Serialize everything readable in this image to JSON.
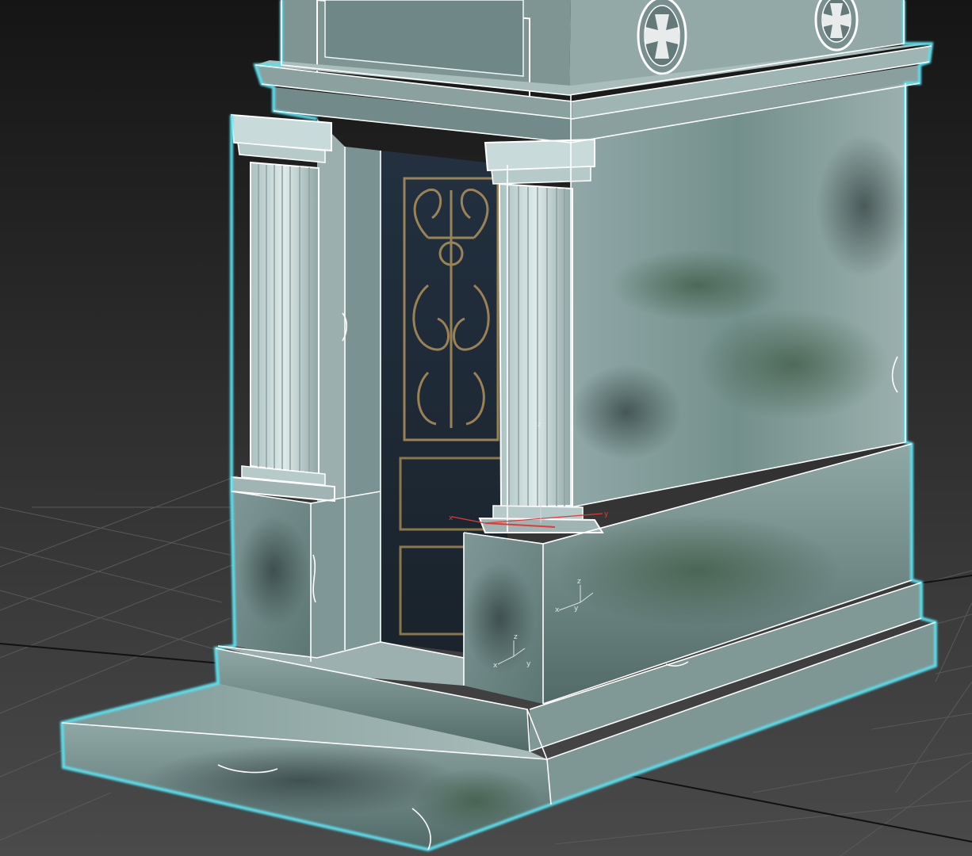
{
  "viewport": {
    "name": "3d-perspective-viewport",
    "background_top": "#151515",
    "background_bottom": "#4a4a4a",
    "grid_color": "#5a5a5a",
    "grid_axis_color": "#0e0e0e"
  },
  "scene": {
    "object": "mausoleum-model",
    "selection_color": "#59e1ef",
    "wire_color": "#ffffff",
    "stone_light": "#8ea7a7",
    "stone_mid": "#5f7a78",
    "stone_dark": "#34494a",
    "moss_color": "#46604a",
    "door_color": "#1e2a33",
    "door_ornament_color": "#a88b52",
    "cross_icon_count": 2
  },
  "gizmos": [
    {
      "name": "pivot-gizmo-center",
      "x_label": "x",
      "y_label": "y",
      "z_label": "z"
    },
    {
      "name": "pivot-gizmo-front",
      "x_label": "x",
      "y_label": "y",
      "z_label": "z"
    },
    {
      "name": "pivot-gizmo-side",
      "x_label": "x",
      "y_label": "y",
      "z_label": "z"
    }
  ]
}
